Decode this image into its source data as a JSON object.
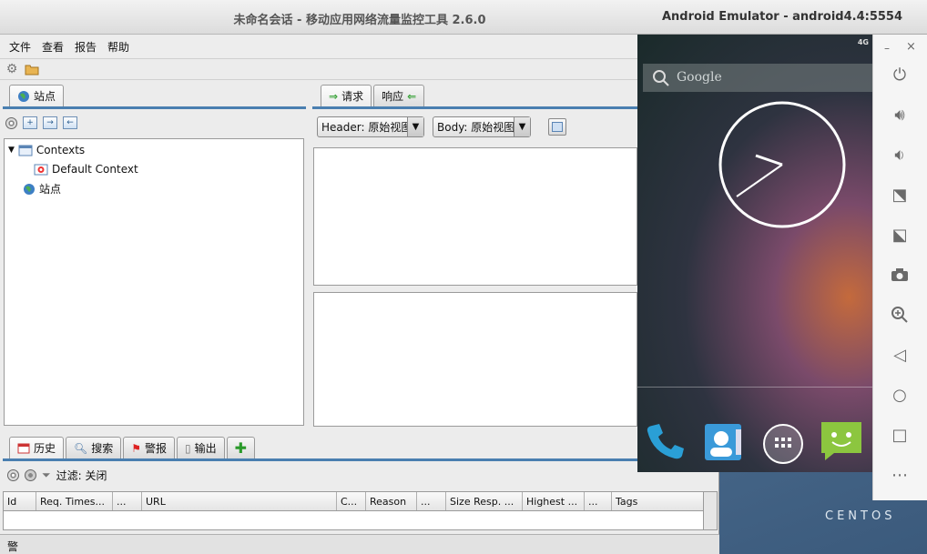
{
  "zap": {
    "title": "未命名会话 - 移动应用网络流量监控工具 2.6.0",
    "menu": [
      "文件",
      "查看",
      "报告",
      "帮助"
    ],
    "left_tab": "站点",
    "right_tabs": [
      "请求",
      "响应"
    ],
    "header_combo": "Header: 原始视图",
    "body_combo": "Body: 原始视图",
    "tree": {
      "contexts": "Contexts",
      "default_context": "Default Context",
      "sites": "站点"
    },
    "bottom_tabs": [
      "历史",
      "搜索",
      "警报",
      "输出"
    ],
    "filter_label": "过滤: 关闭",
    "columns": [
      "Id",
      "Req. Times...",
      "...",
      "URL",
      "C...",
      "Reason",
      "...",
      "Size Resp. ...",
      "Highest ...",
      "...",
      "Tags"
    ],
    "status_bar": "警"
  },
  "emulator": {
    "title": "Android Emulator - android4.4:5554",
    "status_signal": "4G",
    "search_placeholder": "Google",
    "side_icons": [
      "power-icon",
      "volume-up-icon",
      "volume-down-icon",
      "rotate-left-icon",
      "rotate-right-icon",
      "camera-icon",
      "zoom-icon",
      "back-icon",
      "home-icon",
      "overview-icon",
      "more-icon"
    ]
  },
  "desktop": {
    "watermark": "CENTOS"
  }
}
